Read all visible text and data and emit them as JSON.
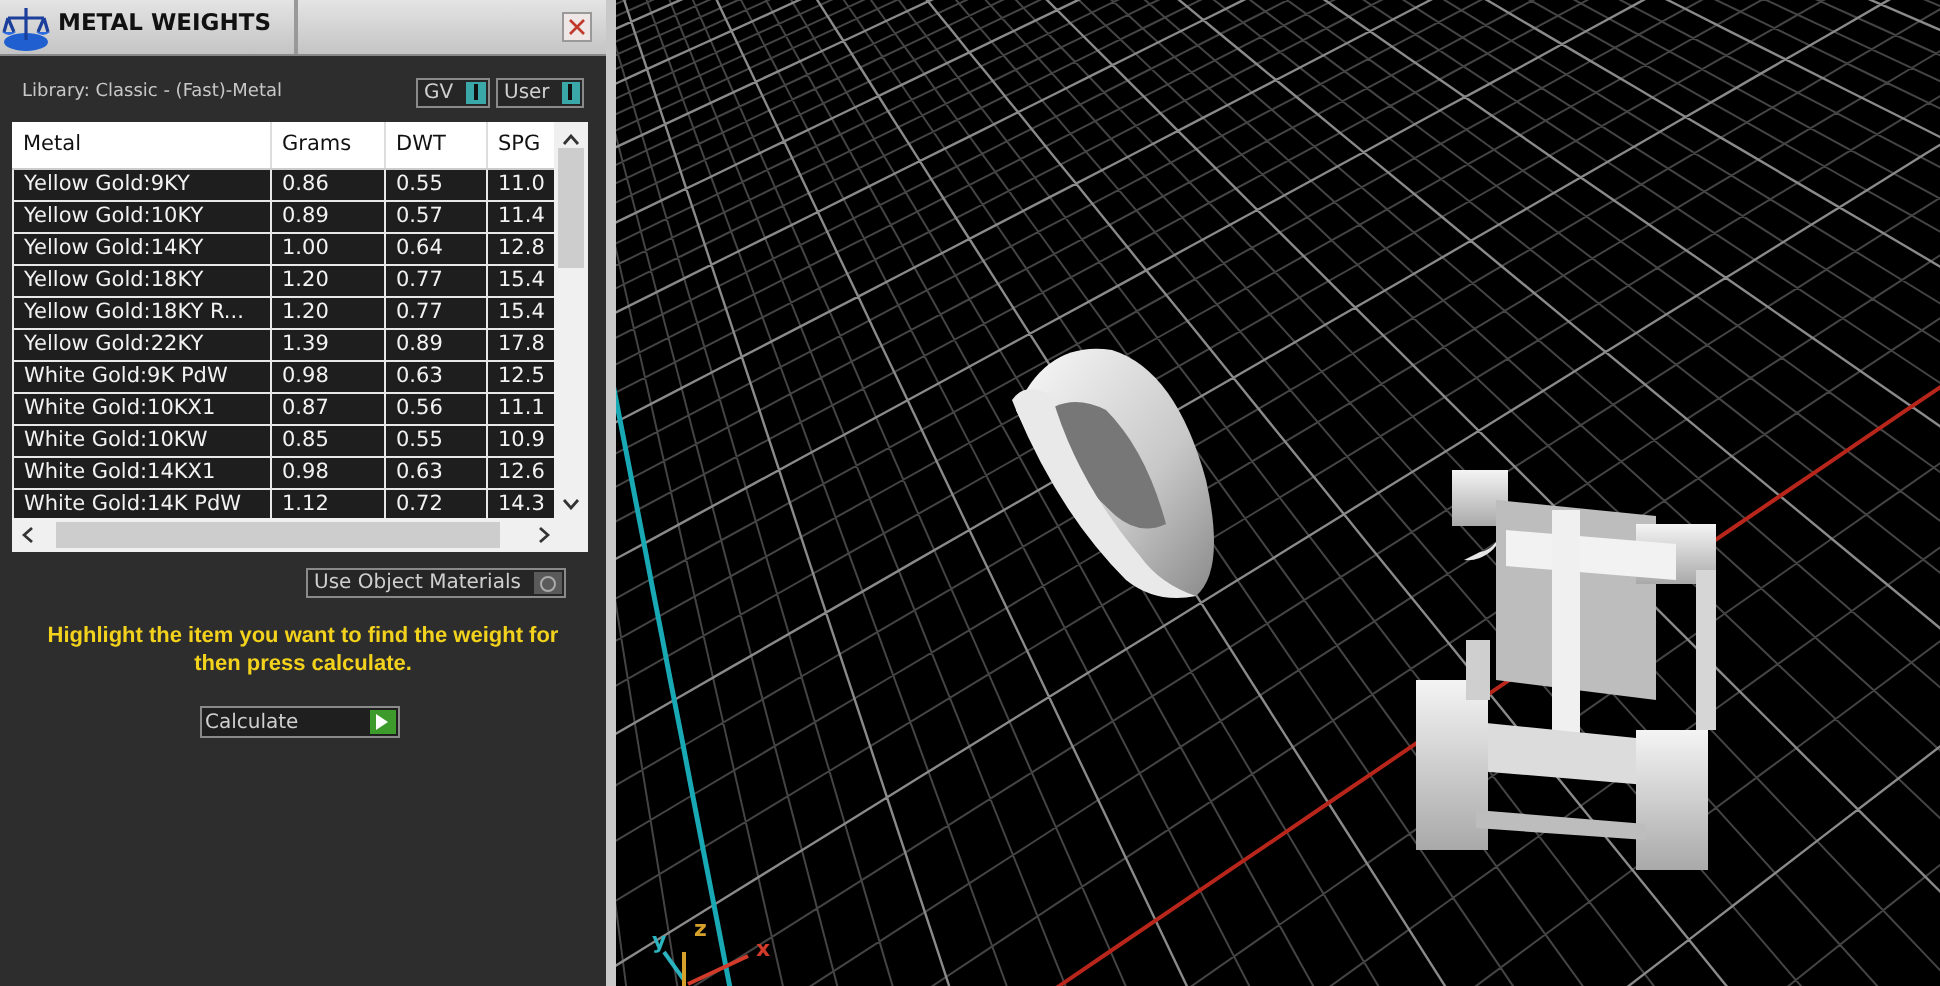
{
  "panel": {
    "title": "METAL WEIGHTS",
    "library": "Library: Classic - (Fast)-Metal",
    "toggles": [
      {
        "label": "GV",
        "on": true
      },
      {
        "label": "User",
        "on": true
      }
    ],
    "table": {
      "columns": [
        "Metal",
        "Grams",
        "DWT",
        "SPG"
      ],
      "rows": [
        [
          "Yellow Gold:9KY",
          "0.86",
          "0.55",
          "11.0"
        ],
        [
          "Yellow Gold:10KY",
          "0.89",
          "0.57",
          "11.4"
        ],
        [
          "Yellow Gold:14KY",
          "1.00",
          "0.64",
          "12.8"
        ],
        [
          "Yellow Gold:18KY",
          "1.20",
          "0.77",
          "15.4"
        ],
        [
          "Yellow Gold:18KY R...",
          "1.20",
          "0.77",
          "15.4"
        ],
        [
          "Yellow Gold:22KY",
          "1.39",
          "0.89",
          "17.8"
        ],
        [
          "White Gold:9K PdW",
          "0.98",
          "0.63",
          "12.5"
        ],
        [
          "White Gold:10KX1",
          "0.87",
          "0.56",
          "11.1"
        ],
        [
          "White Gold:10KW",
          "0.85",
          "0.55",
          "10.9"
        ],
        [
          "White Gold:14KX1",
          "0.98",
          "0.63",
          "12.6"
        ],
        [
          "White Gold:14K PdW",
          "1.12",
          "0.72",
          "14.3"
        ]
      ]
    },
    "use_object_materials": {
      "label": "Use Object Materials",
      "on": false
    },
    "hint": "Highlight the item you want to find the weight for then press calculate.",
    "calculate_button": "Calculate"
  },
  "viewport": {
    "axes": [
      "y",
      "z",
      "x"
    ]
  }
}
